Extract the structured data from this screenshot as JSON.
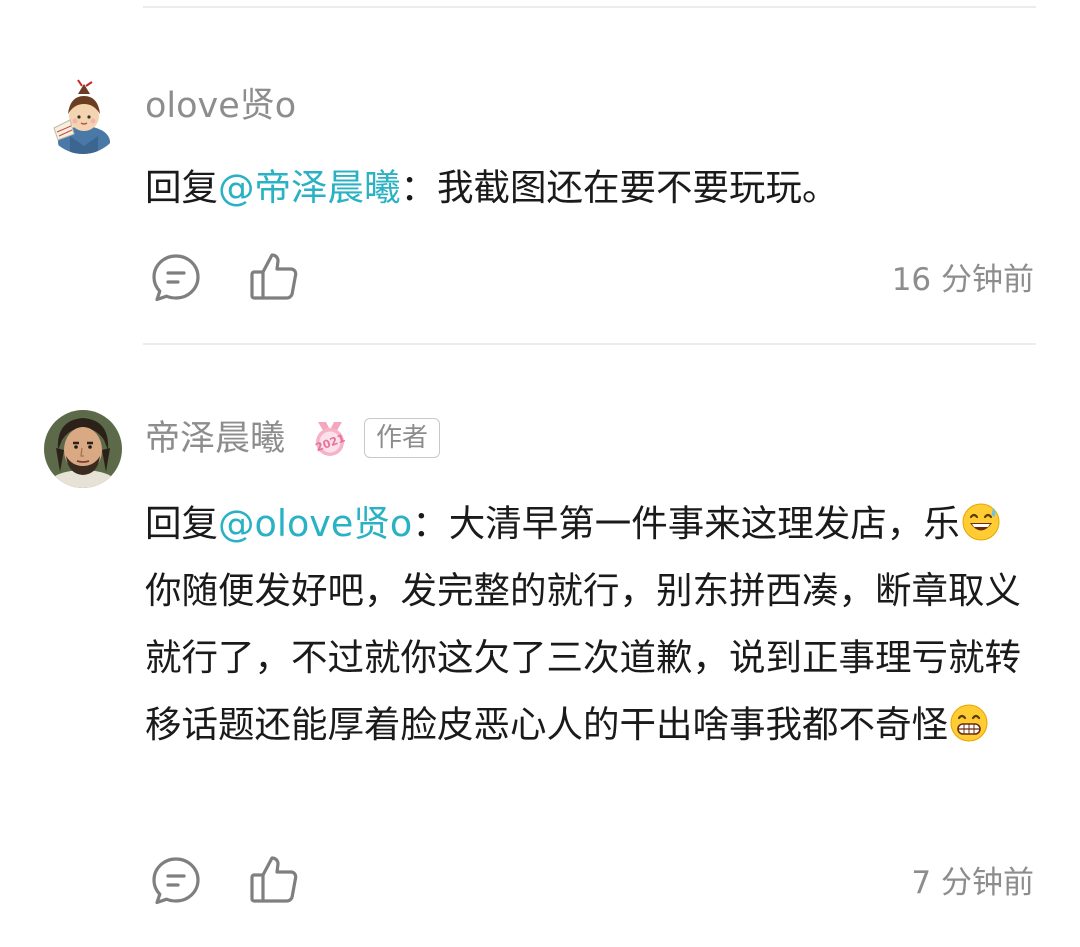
{
  "comments": [
    {
      "username": "olove贤o",
      "reply_prefix": "回复",
      "mention": "@帝泽晨曦",
      "separator": "：",
      "text": "我截图还在要不要玩玩。",
      "time": "16 分钟前"
    },
    {
      "username": "帝泽晨曦",
      "author_tag": "作者",
      "reply_prefix": "回复",
      "mention": "@olove贤o",
      "separator": "：",
      "text_part1": "大清早第一件事来这理发店，乐",
      "text_part2": "你随便发好吧，发完整的就行，别东拼西凑，断章取义就行了，不过就你这欠了三次道歉，说到正事理亏就转移话题还能厚着脸皮恶心人的干出啥事我都不奇怪",
      "emoji_1": "sweat-smile-emoji",
      "emoji_2": "grin-emoji",
      "time": "7 分钟前"
    }
  ],
  "icons": {
    "reply": "comment-bubble-icon",
    "like": "thumbs-up-icon",
    "badge": "pink-medal-badge-icon"
  },
  "colors": {
    "mention": "#2ab2c4",
    "meta": "#8d8d8d",
    "text": "#1a1a1a",
    "divider": "#ececec"
  }
}
